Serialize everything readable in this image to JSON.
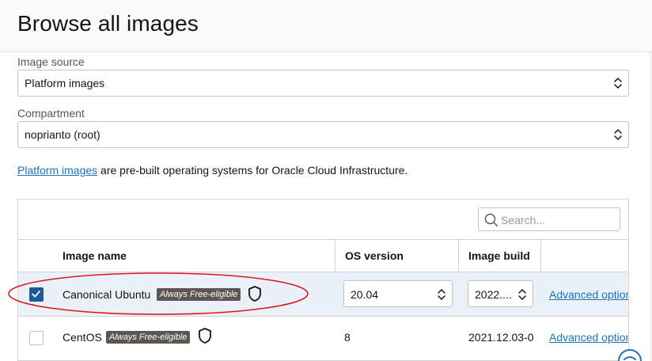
{
  "page": {
    "title": "Browse all images"
  },
  "image_source": {
    "label": "Image source",
    "value": "Platform images"
  },
  "compartment": {
    "label": "Compartment",
    "value": "noprianto (root)"
  },
  "info": {
    "link_text": "Platform images",
    "rest": " are pre-built operating systems for Oracle Cloud Infrastructure."
  },
  "search": {
    "placeholder": "Search..."
  },
  "table": {
    "headers": {
      "name": "Image name",
      "os_version": "OS version",
      "image_build": "Image build"
    },
    "rows": [
      {
        "name": "Canonical Ubuntu",
        "badge": "Always Free-eligible",
        "os_version": "20.04",
        "image_build": "2022....",
        "action": "Advanced options",
        "selected": true
      },
      {
        "name": "CentOS",
        "badge": "Always Free-eligible",
        "os_version": "8",
        "image_build": "2021.12.03-0",
        "action": "Advanced options",
        "selected": false
      }
    ]
  },
  "colors": {
    "accent": "#1e5a99",
    "link": "#1a73b8",
    "annotation": "#e0161d",
    "selected_row": "#eaf1f8"
  }
}
